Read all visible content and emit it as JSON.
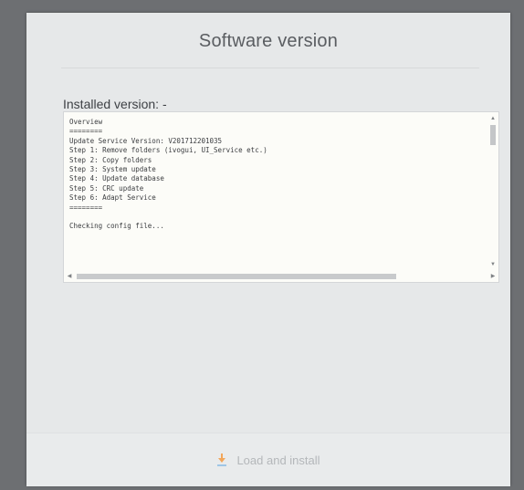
{
  "dialog": {
    "title": "Software version",
    "installed_label": "Installed version: -",
    "log_lines": [
      "Overview",
      "========",
      "Update Service Version: V201712201035",
      "Step 1: Remove folders (ivogui, UI_Service etc.)",
      "Step 2: Copy folders",
      "Step 3: System update",
      "Step 4: Update database",
      "Step 5: CRC update",
      "Step 6: Adapt Service",
      "========",
      "",
      "Checking config file..."
    ],
    "load_button": {
      "label": "Load and install",
      "icon": "download-icon",
      "icon_color": "#f2a65a"
    }
  }
}
